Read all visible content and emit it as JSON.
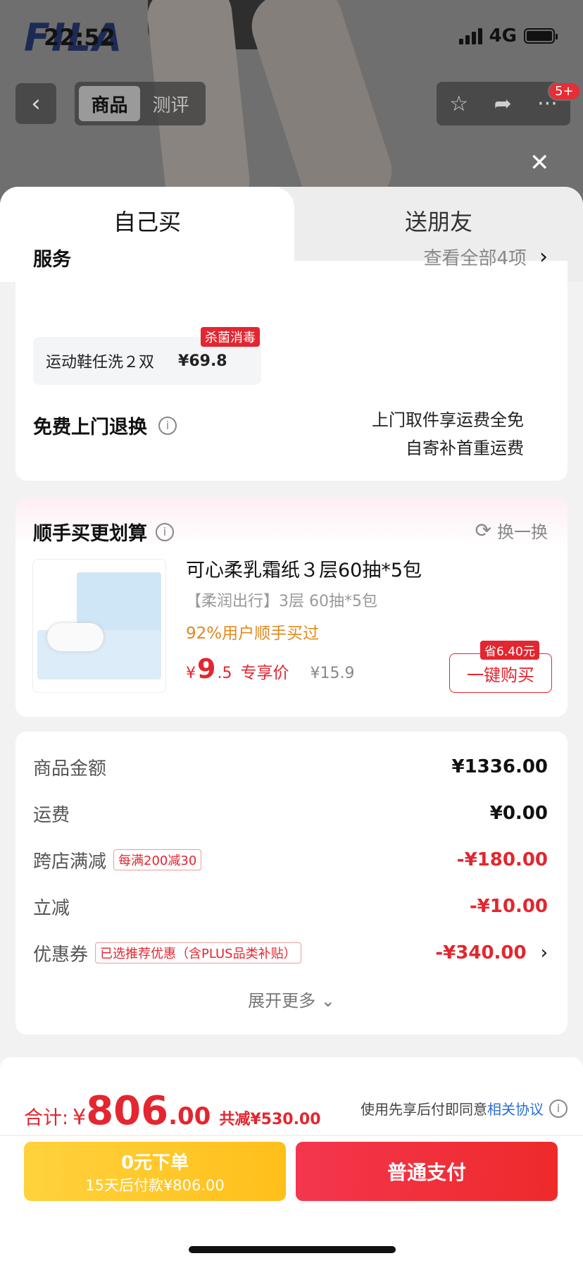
{
  "status_bar": {
    "time": "22:52",
    "network": "4G"
  },
  "background": {
    "brand_logo": "FILA"
  },
  "nav": {
    "back_icon": "chevron-left-icon",
    "tabs": [
      {
        "label": "商品",
        "active": true
      },
      {
        "label": "测评",
        "active": false
      }
    ],
    "action_icons": [
      "star-icon",
      "share-icon",
      "more-icon"
    ],
    "badge": "5+"
  },
  "sheet": {
    "tabs": [
      {
        "label": "自己买",
        "active": true
      },
      {
        "label": "送朋友",
        "active": false
      }
    ]
  },
  "service": {
    "title": "服务",
    "view_all": "查看全部4项",
    "chip": {
      "name": "运动鞋任洗２双",
      "price": "¥69.8",
      "tag": "杀菌消毒"
    },
    "return_title": "免费上门退换",
    "return_line1": "上门取件享运费全免",
    "return_line2": "自寄补首重运费"
  },
  "addon": {
    "title": "顺手买更划算",
    "refresh_label": "换一换",
    "product": {
      "title": "可心柔乳霜纸３层60抽*5包",
      "subtitle": "【柔润出行】3层 60抽*5包",
      "buy_rate": "92%用户顺手买过",
      "price_symbol": "¥",
      "price_int": "9",
      "price_dec": ".5",
      "price_label": "专享价",
      "original_price": "¥15.9",
      "save_tag": "省6.40元",
      "buy_button": "一键购买"
    }
  },
  "summary": {
    "rows": [
      {
        "label": "商品金额",
        "tag": "",
        "value": "¥1336.00",
        "red": false
      },
      {
        "label": "运费",
        "tag": "",
        "value": "¥0.00",
        "red": false
      },
      {
        "label": "跨店满减",
        "tag": "每满200减30",
        "value": "-¥180.00",
        "red": true
      },
      {
        "label": "立减",
        "tag": "",
        "value": "-¥10.00",
        "red": true
      },
      {
        "label": "优惠券",
        "tag": "已选推荐优惠（含PLUS品类补贴）",
        "value": "-¥340.00",
        "red": true
      }
    ],
    "expand_label": "展开更多"
  },
  "footer": {
    "total_label": "合计:",
    "total_symbol": "¥",
    "total_int": "806",
    "total_dec": ".00",
    "total_saved": "共减¥530.00",
    "agreement_text": "使用先享后付即同意",
    "agreement_link": "相关协议",
    "pay_later_line1": "0元下单",
    "pay_later_line2": "15天后付款¥806.00",
    "pay_normal": "普通支付"
  },
  "colors": {
    "accent_red": "#e3262f",
    "pay_later_yellow": "#ffc82b",
    "link_blue": "#2a6fd6"
  }
}
